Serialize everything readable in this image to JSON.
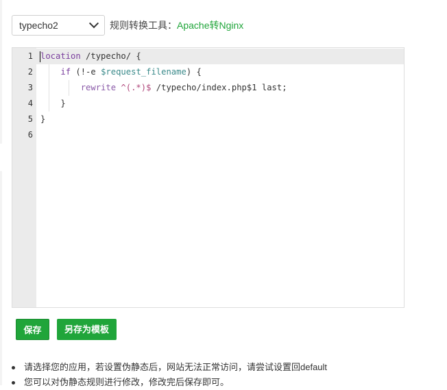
{
  "toolbar": {
    "app_select_value": "typecho2",
    "rule_tool_label": "规则转换工具：",
    "rule_tool_link": "Apache转Nginx"
  },
  "editor": {
    "line_numbers": [
      "1",
      "2",
      "3",
      "4",
      "5",
      "6"
    ],
    "lines": [
      {
        "tokens": [
          {
            "text": "location",
            "cls": "kw"
          },
          {
            "text": " /typecho/ {",
            "cls": ""
          }
        ]
      },
      {
        "tokens": [
          {
            "text": "    ",
            "cls": ""
          },
          {
            "text": "if",
            "cls": "kw"
          },
          {
            "text": " (!-e ",
            "cls": ""
          },
          {
            "text": "$request_filename",
            "cls": "var"
          },
          {
            "text": ") {",
            "cls": ""
          }
        ]
      },
      {
        "tokens": [
          {
            "text": "        ",
            "cls": ""
          },
          {
            "text": "rewrite",
            "cls": "fn"
          },
          {
            "text": " ",
            "cls": ""
          },
          {
            "text": "^(.*)$",
            "cls": "str"
          },
          {
            "text": " /typecho/index.php$1 last;",
            "cls": ""
          }
        ]
      },
      {
        "tokens": [
          {
            "text": "    }",
            "cls": ""
          }
        ]
      },
      {
        "tokens": [
          {
            "text": "}",
            "cls": ""
          }
        ]
      },
      {
        "tokens": []
      }
    ]
  },
  "buttons": {
    "save_label": "保存",
    "save_template_label": "另存为模板"
  },
  "tips": [
    "请选择您的应用，若设置伪静态后，网站无法正常访问，请尝试设置回default",
    "您可以对伪静态规则进行修改，修改完后保存即可。"
  ],
  "colors": {
    "accent": "#20a53a",
    "gutter": "#ebebeb"
  }
}
